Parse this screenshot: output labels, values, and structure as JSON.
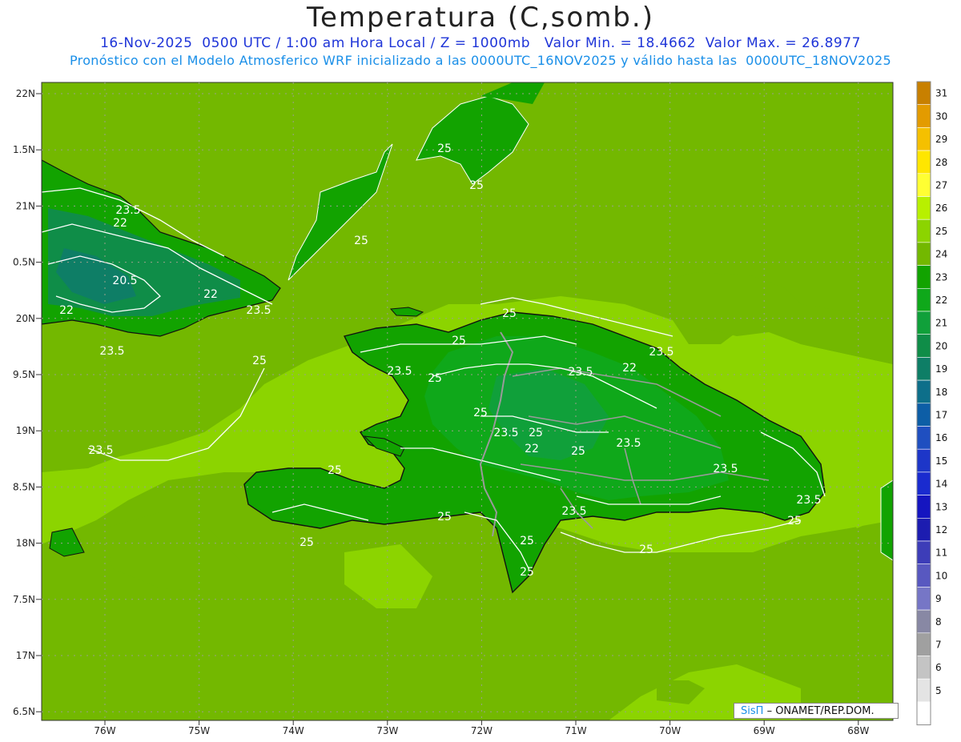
{
  "header": {
    "title": "Temperatura (C,somb.)",
    "line1": "16-Nov-2025  0500 UTC / 1:00 am Hora Local / Z = 1000mb   Valor Min. = 18.4662  Valor Max. = 26.8977",
    "line2": "Pronóstico con el Modelo Atmosferico WRF inicializado a las 0000UTC_16NOV2025 y válido hasta las  0000UTC_18NOV2025"
  },
  "map": {
    "lat_labels": [
      "22N",
      "1.5N",
      "21N",
      "0.5N",
      "20N",
      "9.5N",
      "19N",
      "8.5N",
      "18N",
      "7.5N",
      "17N",
      "6.5N"
    ],
    "lon_labels": [
      "76W",
      "75W",
      "74W",
      "73W",
      "72W",
      "71W",
      "70W",
      "69W",
      "68W"
    ],
    "contour_labels": [
      "25",
      "25",
      "25",
      "23.5",
      "22",
      "20.5",
      "22",
      "22",
      "23.5",
      "23.5",
      "25",
      "25",
      "23.5",
      "25",
      "25",
      "23.5",
      "22",
      "23.5",
      "25",
      "23.5",
      "22",
      "23.5",
      "23.5",
      "23.5",
      "25",
      "25",
      "25",
      "23.5",
      "25",
      "25",
      "25",
      "25",
      "25",
      "23.5",
      "25"
    ],
    "colors": {
      "sea_warm": "#8cd400",
      "sea_mid": "#73b800",
      "land": "#12a300",
      "land_cool": "#0f8d48",
      "coast": "#111111",
      "border": "#9a9a9a",
      "contour": "#ffffff"
    }
  },
  "colorbar": {
    "levels": [
      "31",
      "30",
      "29",
      "28",
      "27",
      "26",
      "25",
      "24",
      "23",
      "22",
      "21",
      "20",
      "19",
      "18",
      "17",
      "16",
      "15",
      "14",
      "13",
      "12",
      "11",
      "10",
      "9",
      "8",
      "7",
      "6",
      "5"
    ],
    "colors": [
      "#c88000",
      "#e39b00",
      "#f5c000",
      "#ffe600",
      "#ffff33",
      "#b8f000",
      "#8cd400",
      "#73b800",
      "#12a300",
      "#0fa81a",
      "#10a03a",
      "#0f8d48",
      "#0e7e66",
      "#0d6f8a",
      "#0d5ea6",
      "#1f4fc0",
      "#1d36c8",
      "#1a2bcf",
      "#1515c0",
      "#1c1cb0",
      "#3d3db8",
      "#5858c0",
      "#7676c6",
      "#8888a4",
      "#a0a0a0",
      "#c4c4c4",
      "#e4e4e4",
      "#ffffff"
    ]
  },
  "credit": {
    "brand": "SisΠ",
    "text": "– ONAMET/REP.DOM."
  }
}
